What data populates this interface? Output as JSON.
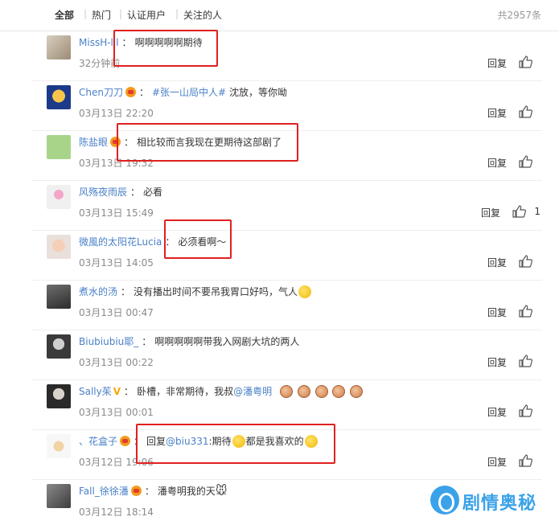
{
  "tabs": [
    "全部",
    "热门",
    "认证用户",
    "关注的人"
  ],
  "total": "共2957条",
  "reply_label": "回复",
  "comments": [
    {
      "user": "MissH-lll",
      "text": "啊啊啊啊啊期待",
      "time": "32分钟前"
    },
    {
      "user": "Chen刀刀",
      "topic": "#张一山局中人#",
      "text": " 沈放，等你呦",
      "time": "03月13日 22:20"
    },
    {
      "user": "陈盐眼",
      "text": "相比较而言我现在更期待这部剧了",
      "time": "03月13日 19:32"
    },
    {
      "user": "风殇夜雨辰",
      "text": "必看",
      "time": "03月13日 15:49",
      "likes": "1"
    },
    {
      "user": "微風的太阳花Lucia",
      "text": "必须看啊～",
      "time": "03月13日 14:05"
    },
    {
      "user": "煮水的汤",
      "text": "没有播出时间不要吊我胃口好吗，气人",
      "time": "03月13日 00:47"
    },
    {
      "user": "Biubiubiu耶_",
      "text": "啊啊啊啊啊带我入网剧大坑的两人",
      "time": "03月13日 00:22"
    },
    {
      "user": "Sally茱",
      "text": "卧槽，非常期待，我叔",
      "mention": "@潘粤明",
      "time": "03月13日 00:01"
    },
    {
      "user": "、花盒子",
      "prefix": "回复",
      "mention": "@biu331",
      "text": ":期待",
      "text2": "都是我喜欢的",
      "time": "03月12日 19:06"
    },
    {
      "user": "Fall_徐徐潘",
      "text": "潘粤明我的天",
      "time": "03月12日 18:14"
    }
  ],
  "watermark": "剧情奥秘",
  "colors": {
    "link": "#4a80c8",
    "highlight_box": "#e02020",
    "watermark": "#3aa2e8"
  }
}
